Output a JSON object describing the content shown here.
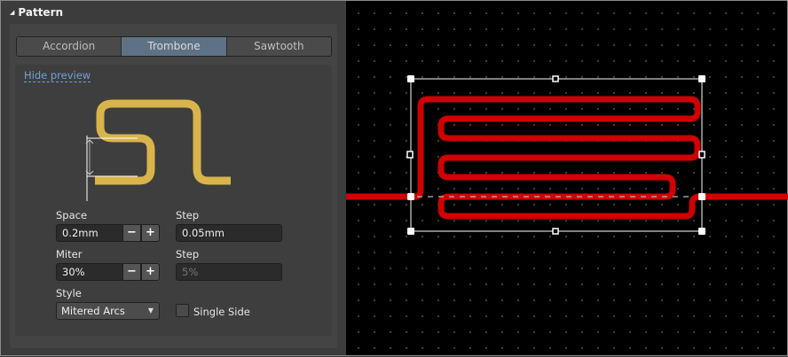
{
  "section": {
    "title": "Pattern"
  },
  "tabs": [
    {
      "label": "Accordion"
    },
    {
      "label": "Trombone",
      "active": true
    },
    {
      "label": "Sawtooth"
    }
  ],
  "preview": {
    "hide_label": "Hide preview",
    "trace_color": "#d9b44a"
  },
  "space": {
    "label": "Space",
    "value": "0.2mm",
    "minus": "−",
    "plus": "+"
  },
  "space_step": {
    "label": "Step",
    "value": "0.05mm"
  },
  "miter": {
    "label": "Miter",
    "value": "30%",
    "minus": "−",
    "plus": "+"
  },
  "miter_step": {
    "label": "Step",
    "value": "5%"
  },
  "style": {
    "label": "Style",
    "value": "Mitered Arcs"
  },
  "single_side": {
    "label": "Single Side",
    "checked": false
  },
  "canvas": {
    "trace_color": "#d00000"
  }
}
